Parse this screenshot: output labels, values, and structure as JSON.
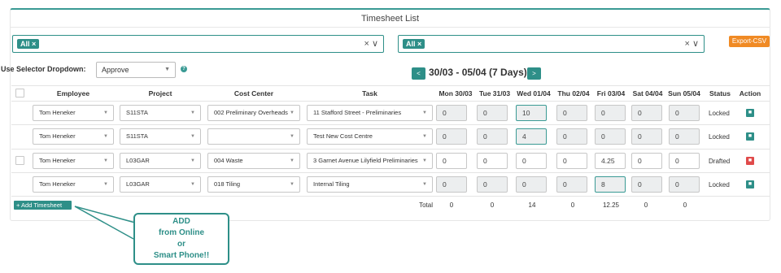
{
  "title": "Timesheet List",
  "filters": [
    {
      "tag": "All ×"
    },
    {
      "tag": "All ×"
    }
  ],
  "filter_controls": "× ∨",
  "export_label": "Export-CSV",
  "selector": {
    "label": "Use Selector Dropdown:",
    "value": "Approve",
    "help": "?"
  },
  "nav": {
    "prev": "<",
    "next": ">",
    "range": "30/03 - 05/04 (7 Days)"
  },
  "columns": [
    "Employee",
    "Project",
    "Cost Center",
    "Task",
    "Mon 30/03",
    "Tue 31/03",
    "Wed 01/04",
    "Thu 02/04",
    "Fri 03/04",
    "Sat 04/04",
    "Sun 05/04",
    "Status",
    "Action"
  ],
  "rows": [
    {
      "employee": "Tom Heneker",
      "project": "S11STA",
      "cost_center": "002 Preliminary Overheads",
      "task": "11 Stafford Street - Preliminaries",
      "days": [
        "0",
        "0",
        "10",
        "0",
        "0",
        "0",
        "0"
      ],
      "status": "Locked",
      "action": "lock-icon"
    },
    {
      "employee": "Tom Heneker",
      "project": "S11STA",
      "cost_center": "",
      "task": "Test New Cost Centre",
      "days": [
        "0",
        "0",
        "4",
        "0",
        "0",
        "0",
        "0"
      ],
      "status": "Locked",
      "action": "lock-icon"
    },
    {
      "employee": "Tom Heneker",
      "project": "L03GAR",
      "cost_center": "004 Waste",
      "task": "3 Garnet Avenue Lilyfield Preliminaries",
      "days": [
        "0",
        "0",
        "0",
        "0",
        "4.25",
        "0",
        "0"
      ],
      "status": "Drafted",
      "action": "trash-icon"
    },
    {
      "employee": "Tom Heneker",
      "project": "L03GAR",
      "cost_center": "018 Tiling",
      "task": "Internal Tiling",
      "days": [
        "0",
        "0",
        "0",
        "0",
        "8",
        "0",
        "0"
      ],
      "status": "Locked",
      "action": "lock-icon"
    }
  ],
  "totals": {
    "label": "Total",
    "values": [
      "0",
      "0",
      "14",
      "0",
      "12.25",
      "0",
      "0"
    ]
  },
  "add_button": "+ Add Timesheet",
  "callout": [
    "ADD",
    "from Online",
    "or",
    "Smart Phone!!"
  ],
  "colors": {
    "accent": "#2e8f88",
    "export": "#f08a24",
    "delete": "#e04b4b"
  }
}
